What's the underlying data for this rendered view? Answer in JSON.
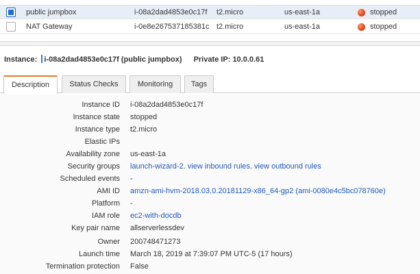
{
  "instances": [
    {
      "selected": true,
      "name": "public jumpbox",
      "id": "i-08a2dad4853e0c17f",
      "type": "t2.micro",
      "az": "us-east-1a",
      "state": "stopped",
      "state_color": "#e8471b"
    },
    {
      "selected": false,
      "name": "NAT Gateway",
      "id": "i-0e8e267537185381c",
      "type": "t2.micro",
      "az": "us-east-1a",
      "state": "stopped",
      "state_color": "#e8471b"
    }
  ],
  "detail": {
    "instance_label": "Instance:",
    "instance_value": "i-08a2dad4853e0c17f (public jumpbox)",
    "private_ip_label": "Private IP:",
    "private_ip_value": "10.0.0.61"
  },
  "tabs": [
    {
      "label": "Description",
      "active": true
    },
    {
      "label": "Status Checks",
      "active": false
    },
    {
      "label": "Monitoring",
      "active": false
    },
    {
      "label": "Tags",
      "active": false
    }
  ],
  "description": {
    "instance_id": {
      "label": "Instance ID",
      "value": "i-08a2dad4853e0c17f"
    },
    "instance_state": {
      "label": "Instance state",
      "value": "stopped"
    },
    "instance_type": {
      "label": "Instance type",
      "value": "t2.micro"
    },
    "elastic_ips": {
      "label": "Elastic IPs",
      "value": ""
    },
    "availability_zone": {
      "label": "Availability zone",
      "value": "us-east-1a"
    },
    "security_groups": {
      "label": "Security groups",
      "group_link": "launch-wizard-2",
      "inbound_link": "view inbound rules",
      "outbound_link": "view outbound rules"
    },
    "scheduled_events": {
      "label": "Scheduled events",
      "value": "-"
    },
    "ami_id": {
      "label": "AMI ID",
      "value": "amzn-ami-hvm-2018.03.0.20181129-x86_64-gp2 (ami-0080e4c5bc078760e)"
    },
    "platform": {
      "label": "Platform",
      "value": "-"
    },
    "iam_role": {
      "label": "IAM role",
      "value": "ec2-with-docdb"
    },
    "key_pair_name": {
      "label": "Key pair name",
      "value": "allserverlessdev"
    },
    "owner": {
      "label": "Owner",
      "value": "200748471273"
    },
    "launch_time": {
      "label": "Launch time",
      "value": "March 18, 2019 at 7:39:07 PM UTC-5 (17 hours)"
    },
    "termination_protection": {
      "label": "Termination protection",
      "value": "False"
    }
  },
  "colors": {
    "accent_link": "#1f58b5",
    "selection": "#1f6fd1",
    "active_tab": "#e07b24",
    "stopped": "#e8471b"
  }
}
